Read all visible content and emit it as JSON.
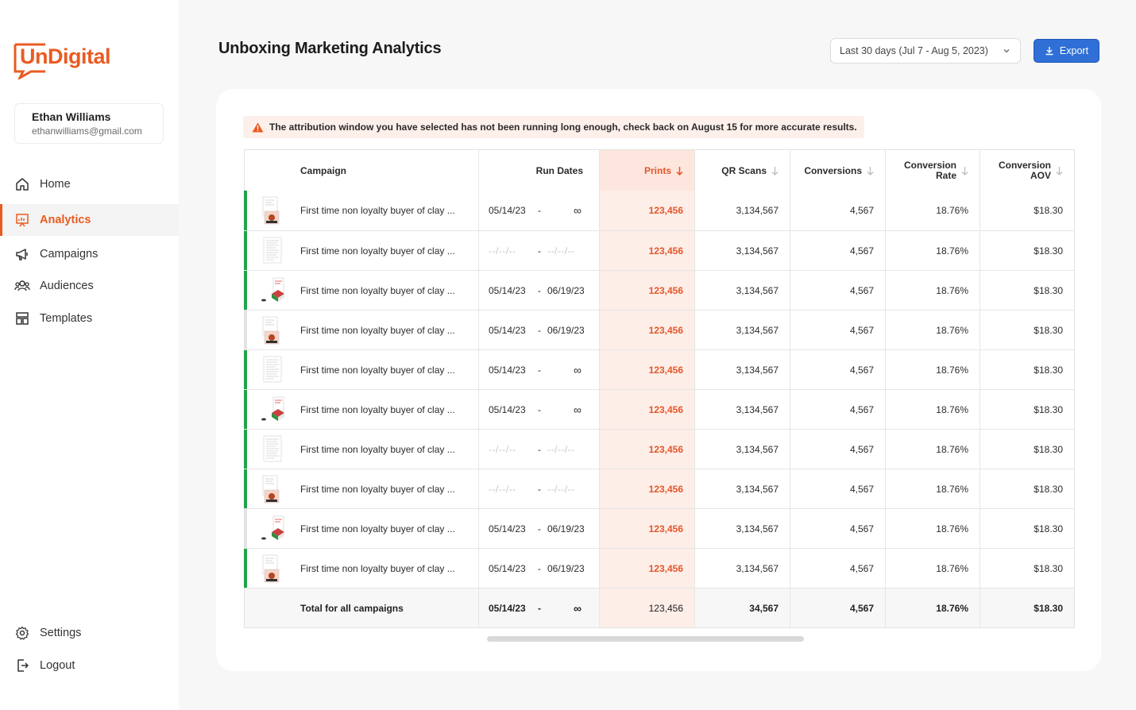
{
  "brand": {
    "logo_text": "UnDigital",
    "accent": "#ea5b22"
  },
  "user": {
    "name": "Ethan Williams",
    "email": "ethanwilliams@gmail.com"
  },
  "nav": [
    {
      "label": "Home",
      "icon": "home-icon"
    },
    {
      "label": "Analytics",
      "icon": "analytics-icon",
      "active": true
    },
    {
      "label": "Campaigns",
      "icon": "megaphone-icon"
    },
    {
      "label": "Audiences",
      "icon": "users-icon"
    },
    {
      "label": "Templates",
      "icon": "templates-icon"
    }
  ],
  "bottom_nav": [
    {
      "label": "Settings",
      "icon": "gear-icon"
    },
    {
      "label": "Logout",
      "icon": "logout-icon"
    }
  ],
  "header": {
    "title": "Unboxing Marketing Analytics",
    "date_range": "Last 30 days (Jul 7 - Aug 5, 2023)",
    "export_label": "Export"
  },
  "warning": "The attribution window you have selected has not been running long enough, check back on August 15 for more accurate results.",
  "table": {
    "columns": {
      "campaign": "Campaign",
      "run_dates": "Run Dates",
      "prints": "Prints",
      "qr_scans": "QR Scans",
      "conversions": "Conversions",
      "conversion_rate_1": "Conversion",
      "conversion_rate_2": "Rate",
      "conversion_aov_1": "Conversion",
      "conversion_aov_2": "AOV"
    },
    "rows": [
      {
        "status": "green",
        "thumb": "letter",
        "name": "First time non loyalty buyer of clay ...",
        "start": "05/14/23",
        "end": "∞",
        "prints": "123,456",
        "qr": "3,134,567",
        "conv": "4,567",
        "rate": "18.76%",
        "aov": "$18.30"
      },
      {
        "status": "green",
        "thumb": "doc",
        "name": "First time non loyalty buyer of clay ...",
        "start": "--/--/--",
        "end": "--/--/--",
        "prints": "123,456",
        "qr": "3,134,567",
        "conv": "4,567",
        "rate": "18.76%",
        "aov": "$18.30"
      },
      {
        "status": "green",
        "thumb": "mailer",
        "name": "First time non loyalty buyer of clay ...",
        "start": "05/14/23",
        "end": "06/19/23",
        "prints": "123,456",
        "qr": "3,134,567",
        "conv": "4,567",
        "rate": "18.76%",
        "aov": "$18.30"
      },
      {
        "status": "gray",
        "thumb": "letter",
        "name": "First time non loyalty buyer of clay ...",
        "start": "05/14/23",
        "end": "06/19/23",
        "prints": "123,456",
        "qr": "3,134,567",
        "conv": "4,567",
        "rate": "18.76%",
        "aov": "$18.30"
      },
      {
        "status": "green",
        "thumb": "doc",
        "name": "First time non loyalty buyer of clay ...",
        "start": "05/14/23",
        "end": "∞",
        "prints": "123,456",
        "qr": "3,134,567",
        "conv": "4,567",
        "rate": "18.76%",
        "aov": "$18.30"
      },
      {
        "status": "green",
        "thumb": "mailer",
        "name": "First time non loyalty buyer of clay ...",
        "start": "05/14/23",
        "end": "∞",
        "prints": "123,456",
        "qr": "3,134,567",
        "conv": "4,567",
        "rate": "18.76%",
        "aov": "$18.30"
      },
      {
        "status": "green",
        "thumb": "doc",
        "name": "First time non loyalty buyer of clay ...",
        "start": "--/--/--",
        "end": "--/--/--",
        "prints": "123,456",
        "qr": "3,134,567",
        "conv": "4,567",
        "rate": "18.76%",
        "aov": "$18.30"
      },
      {
        "status": "green",
        "thumb": "letter",
        "name": "First time non loyalty buyer of clay ...",
        "start": "--/--/--",
        "end": "--/--/--",
        "prints": "123,456",
        "qr": "3,134,567",
        "conv": "4,567",
        "rate": "18.76%",
        "aov": "$18.30"
      },
      {
        "status": "gray",
        "thumb": "mailer",
        "name": "First time non loyalty buyer of clay ...",
        "start": "05/14/23",
        "end": "06/19/23",
        "prints": "123,456",
        "qr": "3,134,567",
        "conv": "4,567",
        "rate": "18.76%",
        "aov": "$18.30"
      },
      {
        "status": "green",
        "thumb": "letter",
        "name": "First time non loyalty buyer of clay ...",
        "start": "05/14/23",
        "end": "06/19/23",
        "prints": "123,456",
        "qr": "3,134,567",
        "conv": "4,567",
        "rate": "18.76%",
        "aov": "$18.30"
      }
    ],
    "total": {
      "name": "Total for all campaigns",
      "start": "05/14/23",
      "end": "∞",
      "prints": "123,456",
      "qr": "34,567",
      "conv": "4,567",
      "rate": "18.76%",
      "aov": "$18.30"
    },
    "dash": "-"
  },
  "colors": {
    "green_status": "#22a44a",
    "gray_status": "#e2e2e2",
    "primary": "#2f6fd6",
    "prints_highlight": "#fdeee8"
  }
}
